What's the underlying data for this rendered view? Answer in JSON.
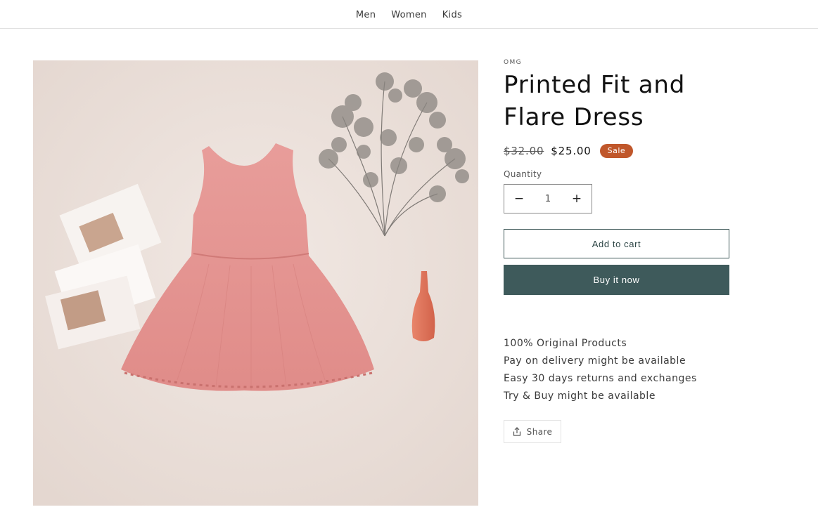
{
  "nav": {
    "links": [
      {
        "label": "Men"
      },
      {
        "label": "Women"
      },
      {
        "label": "Kids"
      }
    ]
  },
  "product": {
    "vendor": "OMG",
    "title": "Printed Fit and Flare Dress",
    "price_compare": "$32.00",
    "price_sale": "$25.00",
    "badge": "Sale",
    "image_icon": "pink-sleeveless-dress-photo"
  },
  "quantity": {
    "label": "Quantity",
    "value": "1",
    "decrease_icon": "minus-icon",
    "increase_icon": "plus-icon"
  },
  "buttons": {
    "add_to_cart": "Add to cart",
    "buy_now": "Buy it now"
  },
  "features": [
    "100% Original Products",
    "Pay on delivery might be available",
    "Easy 30 days returns and exchanges",
    "Try & Buy might be available"
  ],
  "share": {
    "label": "Share",
    "icon": "share-icon"
  },
  "colors": {
    "sale_badge": "#c0572b",
    "buy_button": "#3e5a5b",
    "cart_border": "#3e5858"
  }
}
